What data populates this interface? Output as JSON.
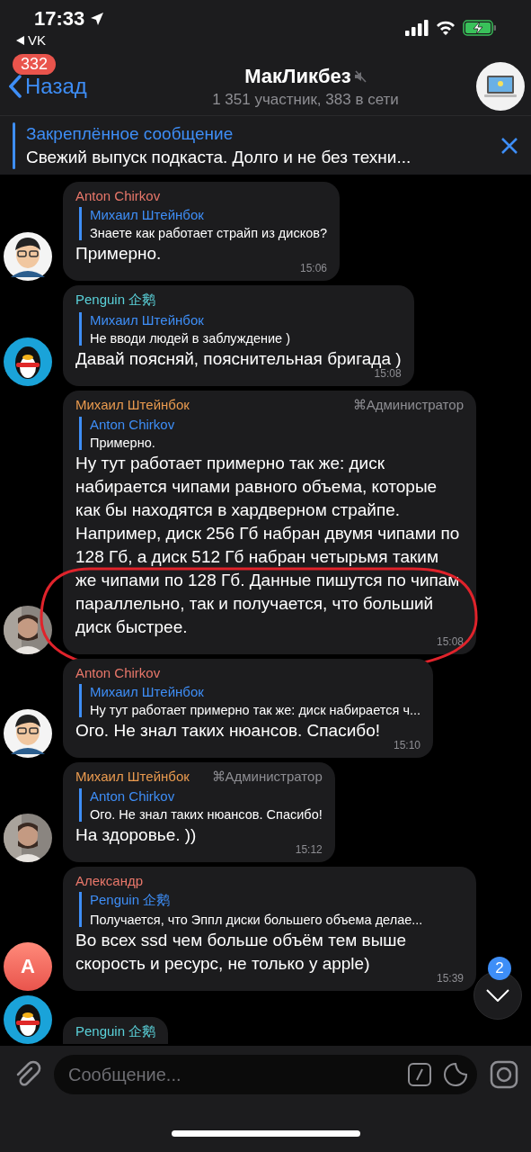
{
  "status_bar": {
    "time": "17:33",
    "back_app": "VK"
  },
  "header": {
    "back_label": "Назад",
    "unread_badge": "332",
    "title": "МакЛикбез",
    "muted": true,
    "subtitle": "1 351 участник, 383 в сети"
  },
  "pinned": {
    "label": "Закреплённое сообщение",
    "text": "Свежий выпуск подкаста. Долго и не без техни..."
  },
  "messages": [
    {
      "author": "Anton Chirkov",
      "color": "#e8776a",
      "avatar": {
        "kind": "cartoon"
      },
      "reply_author": "Михаил Штейнбок",
      "reply_text": "Знаете как работает страйп из дисков?",
      "text": "Примерно.",
      "time": "15:06"
    },
    {
      "author": "Penguin 企鹅",
      "color": "#5ad1d9",
      "avatar": {
        "kind": "penguin"
      },
      "reply_author": "Михаил Штейнбок",
      "reply_text": "Не вводи людей в заблуждение )",
      "text": "Давай поясняй, пояснительная бригада )",
      "time": "15:08"
    },
    {
      "author": "Михаил Штейнбок",
      "color": "#e99a4f",
      "badge": "⌘Администратор",
      "avatar": {
        "kind": "photo"
      },
      "reply_author": "Anton Chirkov",
      "reply_text": "Примерно.",
      "text": "Ну тут работает примерно так же: диск набирается чипами равного объема, которые как бы находятся в хардверном страйпе. Например, диск 256 Гб набран двумя чипами по 128 Гб, а диск 512 Гб набран четырьмя таким же чипами по 128 Гб. Данные пишутся по чипам параллельно, так и получается, что больший диск быстрее.",
      "time": "15:08",
      "annotation": {
        "kind": "ellipse"
      }
    },
    {
      "author": "Anton Chirkov",
      "color": "#e8776a",
      "avatar": {
        "kind": "cartoon"
      },
      "reply_author": "Михаил Штейнбок",
      "reply_text": "Ну тут работает примерно так же: диск набирается ч...",
      "text": "Ого. Не знал таких нюансов. Спасибо!",
      "time": "15:10"
    },
    {
      "author": "Михаил Штейнбок",
      "color": "#e99a4f",
      "badge": "⌘Администратор",
      "avatar": {
        "kind": "photo"
      },
      "reply_author": "Anton Chirkov",
      "reply_text": "Ого. Не знал таких нюансов. Спасибо!",
      "text": "На здоровье. ))",
      "time": "15:12"
    },
    {
      "author": "Александр",
      "color": "#e8776a",
      "avatar": {
        "kind": "letter",
        "letter": "A"
      },
      "reply_author": "Penguin 企鹅",
      "reply_text": "Получается, что Эппл диски большего объема делае...",
      "text": "Во всех ssd чем больше объём тем выше скорость и ресурс, не только у apple)",
      "time": "15:39"
    },
    {
      "author": "Penguin 企鹅",
      "color": "#5ad1d9",
      "avatar": {
        "kind": "penguin"
      },
      "partial": true
    }
  ],
  "scroll_down": {
    "badge": "2"
  },
  "composer": {
    "placeholder": "Сообщение..."
  }
}
